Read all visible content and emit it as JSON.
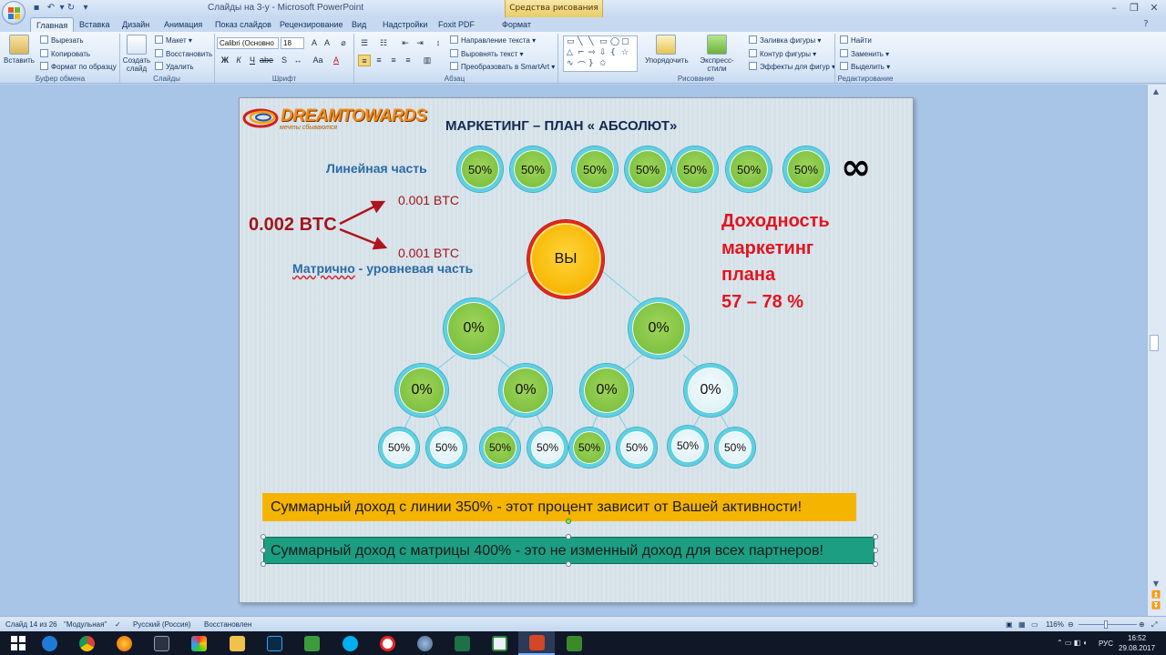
{
  "window": {
    "title": "Слайды на 3-у - Microsoft PowerPoint",
    "contextual_tools": "Средства рисования"
  },
  "tabs": [
    {
      "label": "Главная",
      "active": true
    },
    {
      "label": "Вставка"
    },
    {
      "label": "Дизайн"
    },
    {
      "label": "Анимация"
    },
    {
      "label": "Показ слайдов"
    },
    {
      "label": "Рецензирование"
    },
    {
      "label": "Вид"
    },
    {
      "label": "Надстройки"
    },
    {
      "label": "Foxit PDF"
    },
    {
      "label": "Формат"
    }
  ],
  "ribbon": {
    "clipboard": {
      "paste": "Вставить",
      "cut": "Вырезать",
      "copy": "Копировать",
      "format_painter": "Формат по образцу",
      "group": "Буфер обмена"
    },
    "slides": {
      "new_slide": "Создать слайд",
      "layout": "Макет",
      "reset": "Восстановить",
      "delete": "Удалить",
      "group": "Слайды"
    },
    "font": {
      "name": "Calibri (Основно",
      "size": "18",
      "group": "Шрифт"
    },
    "paragraph": {
      "text_direction": "Направление текста",
      "align_text": "Выровнять текст",
      "smartart": "Преобразовать в SmartArt",
      "group": "Абзац"
    },
    "drawing": {
      "arrange": "Упорядочить",
      "quick_styles": "Экспресс-стили",
      "shape_fill": "Заливка фигуры",
      "shape_outline": "Контур фигуры",
      "shape_effects": "Эффекты для фигур",
      "group": "Рисование"
    },
    "editing": {
      "find": "Найти",
      "replace": "Заменить",
      "select": "Выделить",
      "group": "Редактирование"
    }
  },
  "slide": {
    "logo": {
      "text": "DREAMTOWARDS",
      "subtitle": "мечты сбываются"
    },
    "title": "МАРКЕТИНГ – ПЛАН « АБСОЛЮТ»",
    "linear_label": "Линейная часть",
    "linear_circles": [
      "50%",
      "50%",
      "50%",
      "50%",
      "50%",
      "50%",
      "50%"
    ],
    "infinity": "∞",
    "total_btc": "0.002 BTC",
    "btc_split_top": "0.001 BTC",
    "btc_split_bottom": "0.001 BTC",
    "matrix_label_1": "Матрично",
    "matrix_label_2": " - уровневая часть",
    "yield_lines": [
      "Доходность",
      "маркетинг",
      "плана",
      "57 – 78 %"
    ],
    "tree": {
      "root": "ВЫ",
      "level1": [
        "0%",
        "0%"
      ],
      "level2": [
        "0%",
        "0%",
        "0%",
        "0%"
      ],
      "level3": [
        "50%",
        "50%",
        "50%",
        "50%",
        "50%",
        "50%",
        "50%",
        "50%"
      ]
    },
    "banner_linear": "Суммарный доход  с линии 350%   - этот процент зависит от Вашей активности!",
    "banner_matrix": "Суммарный доход  с матрицы 400% - это не изменный доход для всех партнеров!"
  },
  "status": {
    "slide_info": "Слайд 14 из 26",
    "theme": "\"Модульная\"",
    "language": "Русский (Россия)",
    "state": "Восстановлен",
    "zoom": "116%"
  },
  "tray": {
    "lang": "РУС",
    "time": "16:52",
    "date": "29.08.2017"
  },
  "colors": {
    "accent_green": "#7fc241",
    "ring_cyan": "#5fd0e0",
    "banner_orange": "#f5b400",
    "banner_teal": "#1c9e83",
    "text_red": "#e2141f"
  }
}
